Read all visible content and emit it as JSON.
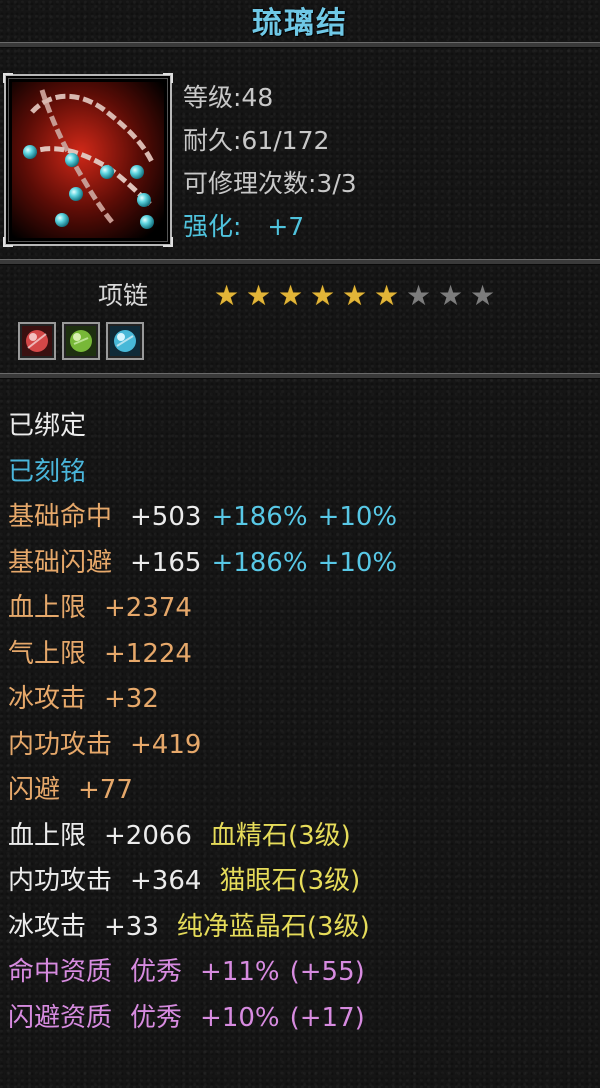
{
  "item": {
    "name": "琉璃结",
    "level_label": "等级:48",
    "durability_label": "耐久:61/172",
    "repair_label": "可修理次数:3/3",
    "enhance_label": "强化:",
    "enhance_value": "+7",
    "type": "项链",
    "stars_total": 9,
    "stars_filled": 6,
    "icon": "chain-necklace-icon",
    "gems": [
      "red-gem-icon",
      "green-gem-icon",
      "blue-gem-icon"
    ]
  },
  "status": {
    "bound": "已绑定",
    "engraved": "已刻铭"
  },
  "base_attrs": [
    {
      "name": "基础命中",
      "value": "+503",
      "pct1": "+186%",
      "pct2": "+10%"
    },
    {
      "name": "基础闪避",
      "value": "+165",
      "pct1": "+186%",
      "pct2": "+10%"
    }
  ],
  "bonus_attrs": [
    {
      "name": "血上限",
      "value": "+2374"
    },
    {
      "name": "气上限",
      "value": "+1224"
    },
    {
      "name": "冰攻击",
      "value": "+32"
    },
    {
      "name": "内功攻击",
      "value": "+419"
    },
    {
      "name": "闪避",
      "value": "+77"
    }
  ],
  "gem_attrs": [
    {
      "name": "血上限",
      "value": "+2066",
      "gem": "血精石(3级)"
    },
    {
      "name": "内功攻击",
      "value": "+364",
      "gem": "猫眼石(3级)"
    },
    {
      "name": "冰攻击",
      "value": "+33",
      "gem": "纯净蓝晶石(3级)"
    }
  ],
  "aptitude": [
    {
      "name": "命中资质",
      "grade": "优秀",
      "value": "+11%",
      "extra": "(+55)"
    },
    {
      "name": "闪避资质",
      "grade": "优秀",
      "value": "+10%",
      "extra": "(+17)"
    }
  ],
  "colors": {
    "title": "#6fc8e6",
    "blue": "#4ab6db",
    "orange": "#e6a86a",
    "yellow": "#e6dc5a",
    "pink": "#d78be0",
    "star_on": "#e2b538",
    "star_off": "#7c7c7c"
  }
}
